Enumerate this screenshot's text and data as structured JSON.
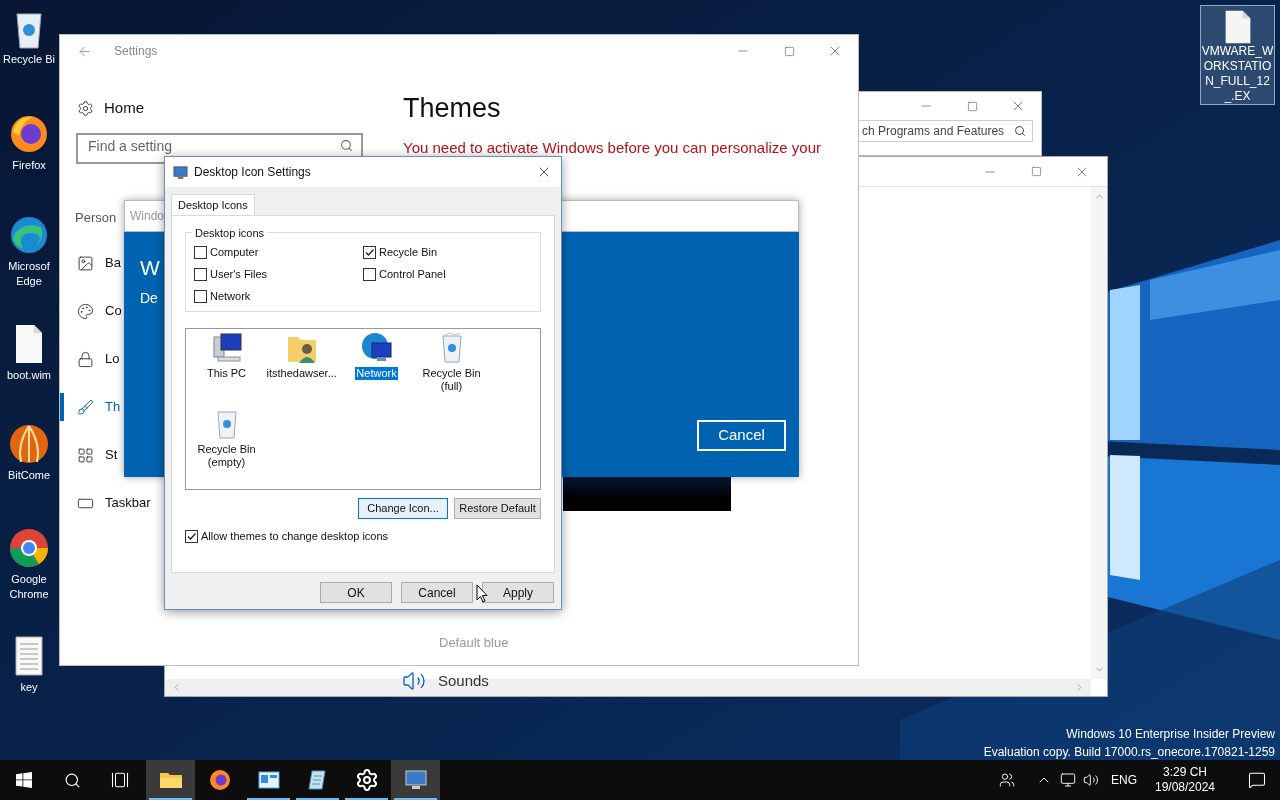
{
  "desktop_icons": [
    {
      "label": "Recycle Bi"
    },
    {
      "label": "Firefox"
    },
    {
      "label": "Microsof Edge"
    },
    {
      "label": "boot.wim"
    },
    {
      "label": "BitCome"
    },
    {
      "label": "Google Chrome"
    },
    {
      "label": "key"
    }
  ],
  "desktop_file": {
    "label": "VMWARE_WORKSTATION_FULL_12_.EX",
    "selected": true
  },
  "programs_window": {
    "search_placeholder": "ch Programs and Features"
  },
  "settings": {
    "title": "Settings",
    "home": "Home",
    "search_placeholder": "Find a setting",
    "section": "Person",
    "nav": [
      {
        "label": "Ba",
        "selected": false
      },
      {
        "label": "Co",
        "selected": false
      },
      {
        "label": "Lo",
        "selected": false
      },
      {
        "label": "Th",
        "selected": true
      },
      {
        "label": "St",
        "selected": false
      },
      {
        "label": "Taskbar",
        "selected": false
      }
    ],
    "heading": "Themes",
    "notice": "You need to activate Windows before you can personalize your",
    "theme_caption": "Default blue",
    "sounds": "Sounds"
  },
  "windows_dialog": {
    "title": "Windo",
    "heading": "W",
    "subheading": "De",
    "button": "Cancel"
  },
  "dialog": {
    "title": "Desktop Icon Settings",
    "tabs": [
      {
        "label": "Desktop Icons",
        "selected": true
      }
    ],
    "group_label": "Desktop icons",
    "checkboxes": [
      {
        "label": "Computer",
        "checked": false
      },
      {
        "label": "Recycle Bin",
        "checked": true
      },
      {
        "label": "User's Files",
        "checked": false
      },
      {
        "label": "Control Panel",
        "checked": false
      },
      {
        "label": "Network",
        "checked": false
      }
    ],
    "icons": [
      {
        "label": "This PC",
        "selected": false
      },
      {
        "label": "itsthedawser...",
        "selected": false
      },
      {
        "label": "Network",
        "selected": true
      },
      {
        "label": "Recycle Bin (full)",
        "selected": false
      },
      {
        "label": "Recycle Bin (empty)",
        "selected": false
      }
    ],
    "change_icon": "Change Icon...",
    "restore_default": "Restore Default",
    "allow_themes": {
      "label": "Allow themes to change desktop icons",
      "checked": true
    },
    "footer": [
      "OK",
      "Cancel",
      "Apply"
    ]
  },
  "watermark": [
    "Windows 10 Enterprise Insider Preview",
    "Evaluation copy. Build 17000.rs_onecore.170821-1259"
  ],
  "taskbar": {
    "apps": [
      {
        "active": true,
        "running": true
      },
      {
        "active": false,
        "running": false
      },
      {
        "active": false,
        "running": true
      },
      {
        "active": false,
        "running": true
      },
      {
        "active": false,
        "running": true
      },
      {
        "active": true,
        "running": true
      }
    ],
    "language": "ENG",
    "time": "3:29 CH",
    "date": "19/08/2024"
  }
}
